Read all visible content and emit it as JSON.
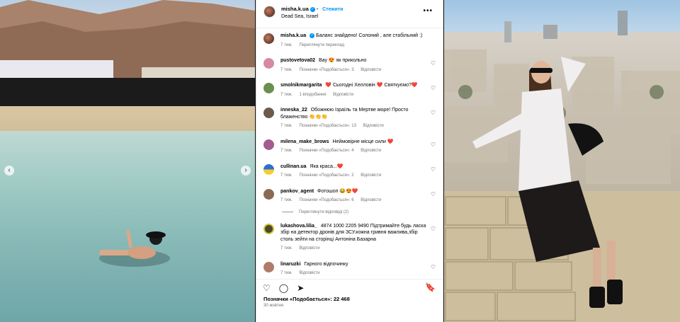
{
  "post": {
    "author": "misha.k.ua",
    "follow_label": "Стежити",
    "location": "Dead Sea, Israel",
    "more_label": "•••",
    "caption": "Баланс знайдено! Солоний , але стабільний :)",
    "caption_time": "7 тиж.",
    "caption_translate": "Переглянути переклад",
    "likes": "Позначки «Подобається»: 22 468",
    "date": "30 жовтня"
  },
  "comments": [
    {
      "user": "pustovetova02",
      "text": "Вау 😍 як прикольно",
      "time": "7 тиж.",
      "likes": "Позначки «Подобається»: 3",
      "reply": "Відповісти",
      "avatar_color": "#d58aa1"
    },
    {
      "user": "smolnikmargarita",
      "text": "❤️ Сьогодні Хелловін ❤️ Святкуємо?❤️",
      "time": "7 тиж.",
      "likes": "1 вподобання",
      "reply": "Відповісти",
      "avatar_color": "#6b8f4e"
    },
    {
      "user": "inneska_22",
      "text": "Обожнюю Ізраїль та Мертве море! Просто блаженство 👏👏👏",
      "time": "7 тиж.",
      "likes": "Позначки «Подобається»: 13",
      "reply": "Відповісти",
      "avatar_color": "#6b5a4a"
    },
    {
      "user": "milena_make_brows",
      "text": "Неймовірне місце сили ❤️",
      "time": "7 тиж.",
      "likes": "Позначки «Подобається»: 4",
      "reply": "Відповісти",
      "avatar_color": "#a45b8e"
    },
    {
      "user": "cullinan.ua",
      "text": "Яка краса...❤️",
      "time": "7 тиж.",
      "likes": "Позначки «Подобається»: 2",
      "reply": "Відповісти",
      "avatar_color": "#e7c64a"
    },
    {
      "user": "pankov_agent",
      "text": "Фотошоп 😂😍❤️",
      "time": "7 тиж.",
      "likes": "Позначки «Подобається»: 6",
      "reply": "Відповісти",
      "avatar_color": "#8a6a52"
    },
    {
      "user": "lukashova.lilia_",
      "text": "4874 1000 2205 9490 Підтримайте будь ласка збір на детектор дронів для ЗСУ.кожна гривня важлива,збір столь зейти на сторінці Антоніна Базарна",
      "time": "7 тиж.",
      "likes": "",
      "reply": "Відповісти",
      "avatar_color": "#4a4a2a"
    },
    {
      "user": "linaruzki",
      "text": "Гарного відпочинку",
      "time": "7 тиж.",
      "likes": "",
      "reply": "Відповісти",
      "avatar_color": "#b07b6a"
    }
  ],
  "view_replies": "Переглянути відповіді (2)",
  "icons": {
    "heart": "♡",
    "comment": "◯",
    "share": "➤",
    "save": "🔖",
    "prev": "‹",
    "next": "›"
  },
  "colors": {
    "accent": "#0095f6",
    "muted": "#737373"
  }
}
